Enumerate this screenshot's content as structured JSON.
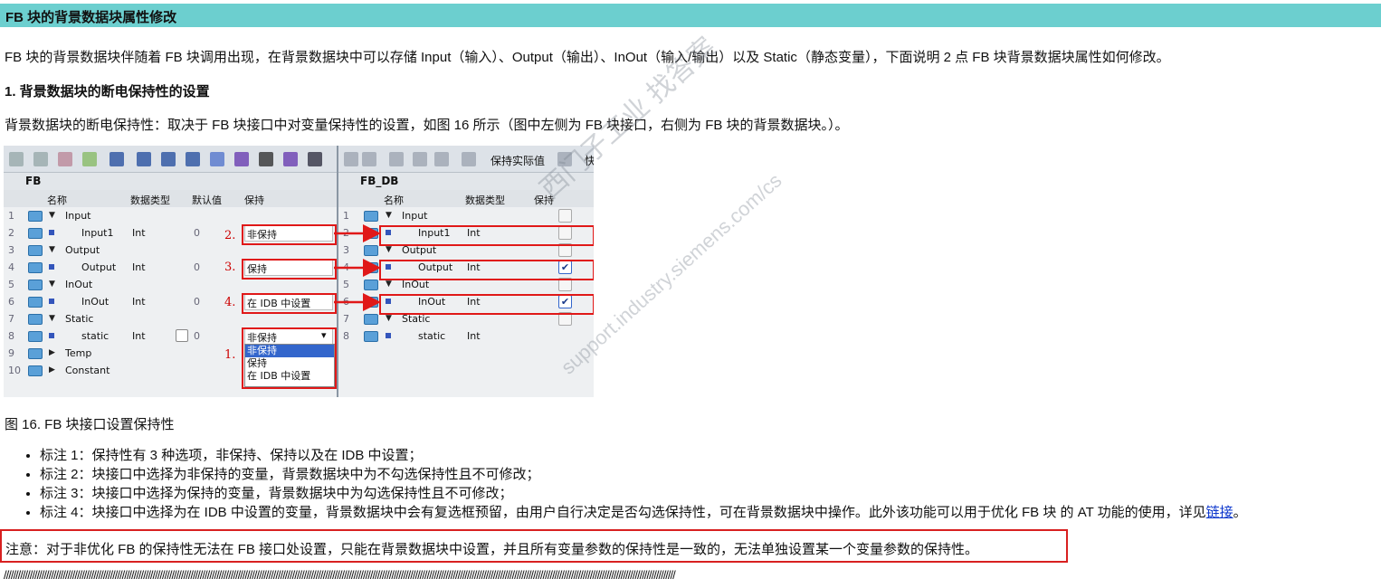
{
  "header": {
    "title": "FB 块的背景数据块属性修改"
  },
  "intro": "FB 块的背景数据块伴随着 FB 块调用出现，在背景数据块中可以存储 Input（输入）、Output（输出）、InOut（输入/输出）以及 Static（静态变量），下面说明 2 点 FB 块背景数据块属性如何修改。",
  "section1": {
    "heading": "1. 背景数据块的断电保持性的设置",
    "desc": "背景数据块的断电保持性：取决于 FB 块接口中对变量保持性的设置，如图 16 所示（图中左侧为 FB 块接口，右侧为 FB 块的背景数据块。）。"
  },
  "figure": {
    "left": {
      "title": "FB",
      "columns": [
        "名称",
        "数据类型",
        "默认值",
        "保持"
      ],
      "rows": [
        {
          "n": "1",
          "name": "Input",
          "type": "",
          "def": "",
          "ret": "",
          "level": 0
        },
        {
          "n": "2",
          "name": "Input1",
          "type": "Int",
          "def": "0",
          "ret": "非保持",
          "level": 1
        },
        {
          "n": "3",
          "name": "Output",
          "type": "",
          "def": "",
          "ret": "",
          "level": 0
        },
        {
          "n": "4",
          "name": "Output",
          "type": "Int",
          "def": "0",
          "ret": "保持",
          "level": 1
        },
        {
          "n": "5",
          "name": "InOut",
          "type": "",
          "def": "",
          "ret": "",
          "level": 0
        },
        {
          "n": "6",
          "name": "InOut",
          "type": "Int",
          "def": "0",
          "ret": "在 IDB 中设置",
          "level": 1
        },
        {
          "n": "7",
          "name": "Static",
          "type": "",
          "def": "",
          "ret": "",
          "level": 0
        },
        {
          "n": "8",
          "name": "static",
          "type": "Int",
          "def": "0",
          "ret": "非保持",
          "level": 1
        },
        {
          "n": "9",
          "name": "Temp",
          "type": "",
          "def": "",
          "ret": "",
          "level": 0
        },
        {
          "n": "10",
          "name": "Constant",
          "type": "",
          "def": "",
          "ret": "",
          "level": 0
        }
      ],
      "dropdown": [
        "非保持",
        "保持",
        "在 IDB 中设置"
      ]
    },
    "right": {
      "title": "FB_DB",
      "toolbar_text": "保持实际值",
      "toolbar_text2": "快",
      "columns": [
        "名称",
        "数据类型",
        "保持"
      ],
      "rows": [
        {
          "n": "1",
          "name": "Input",
          "type": "",
          "checked": false,
          "level": 0
        },
        {
          "n": "2",
          "name": "Input1",
          "type": "Int",
          "checked": false,
          "level": 1
        },
        {
          "n": "3",
          "name": "Output",
          "type": "",
          "checked": false,
          "level": 0
        },
        {
          "n": "4",
          "name": "Output",
          "type": "Int",
          "checked": true,
          "level": 1
        },
        {
          "n": "5",
          "name": "InOut",
          "type": "",
          "checked": false,
          "level": 0
        },
        {
          "n": "6",
          "name": "InOut",
          "type": "Int",
          "checked": true,
          "level": 1
        },
        {
          "n": "7",
          "name": "Static",
          "type": "",
          "checked": false,
          "level": 0
        },
        {
          "n": "8",
          "name": "static",
          "type": "Int",
          "checked": false,
          "level": 1
        }
      ]
    },
    "markers": [
      "2.",
      "3.",
      "4.",
      "1."
    ],
    "watermark": "西门子工业 找答案",
    "watermark_url": "support.industry.siemens.com/cs"
  },
  "caption": "图 16. FB 块接口设置保持性",
  "bullets": [
    "标注 1：保持性有 3 种选项，非保持、保持以及在 IDB 中设置；",
    "标注 2：块接口中选择为非保持的变量，背景数据块中为不勾选保持性且不可修改；",
    "标注 3：块接口中选择为保持的变量，背景数据块中为勾选保持性且不可修改；"
  ],
  "bullet4": {
    "text": "标注 4：块接口中选择为在 IDB 中设置的变量，背景数据块中会有复选框预留，由用户自行决定是否勾选保持性，可在背景数据块中操作。此外该功能可以用于优化 FB 块 的 AT 功能的使用，详见",
    "link": "链接",
    "end": "。"
  },
  "note": "注意：对于非优化 FB 的保持性无法在 FB 接口处设置，只能在背景数据块中设置，并且所有变量参数的保持性是一致的，无法单独设置某一个变量参数的保持性。",
  "separator": "////////////////////////////////////////////////////////////////////////////////////////////////////////////////////////////////////////////////////////////////////////////////////////////////////////////////////////////////////////////////////////////////////////////////////////////",
  "colors": {
    "header_bg": "#6ccfcf",
    "red": "#e01818",
    "link": "#0a35cc"
  }
}
